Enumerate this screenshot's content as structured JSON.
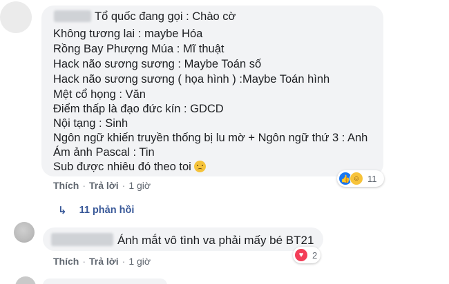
{
  "comment1": {
    "lines": [
      "Tổ quốc đang gọi : Chào cờ",
      "Không tương lai : maybe Hóa",
      "Rồng Bay Phượng Múa : Mĩ thuật",
      "Hack não sương sương : Maybe Toán số",
      "Hack não sương sương ( họa hình ) :Maybe Toán hình",
      "Mệt cổ họng : Văn",
      "Điểm thấp là đạo đức kín : GDCD",
      "Nội tạng : Sinh",
      "Ngôn ngữ khiến truyền thống bị lu mờ + Ngôn ngữ thứ 3 : Anh",
      "Ám ảnh Pascal : Tin",
      "Sub được nhiêu đó theo toi"
    ],
    "like_label": "Thích",
    "reply_label": "Trả lời",
    "time": "1 giờ",
    "reaction_count": "11"
  },
  "replies_link": {
    "arrow": "↳",
    "label": "11 phản hồi"
  },
  "comment2": {
    "text": "Ánh mắt vô tình va phải mấy bé BT21",
    "like_label": "Thích",
    "reply_label": "Trả lời",
    "time": "1 giờ",
    "reaction_count": "2"
  },
  "colors": {
    "bubble": "#f2f3f5",
    "link": "#385898",
    "meta": "#606770",
    "like": "#1877f2",
    "love": "#f33e58",
    "haha": "#f7c33a"
  },
  "icons": [
    "like-icon",
    "haha-icon",
    "love-icon",
    "frowning-emoji-icon",
    "reply-arrow-icon"
  ]
}
